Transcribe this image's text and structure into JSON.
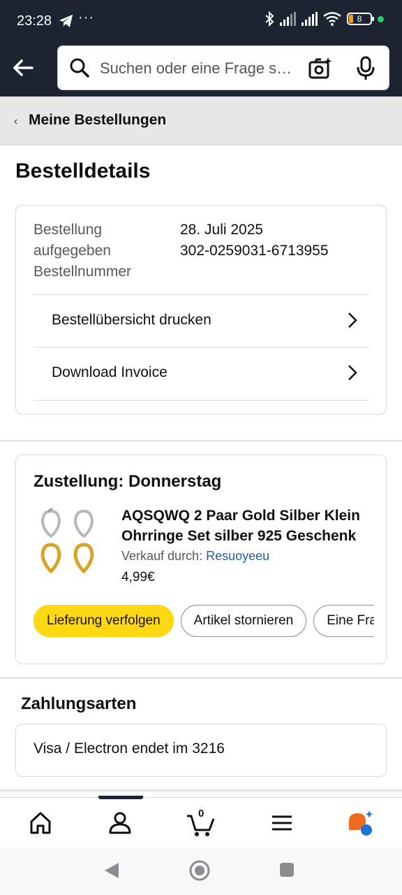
{
  "status_bar": {
    "time": "23:28",
    "dots": "···",
    "battery": "8"
  },
  "search": {
    "placeholder": "Suchen oder eine Frage stellen"
  },
  "breadcrumb": {
    "label": "Meine Bestellungen"
  },
  "page": {
    "title": "Bestelldetails"
  },
  "order": {
    "label_date": "Bestellung aufgegeben",
    "label_number": "Bestellnummer",
    "date": "28. Juli 2025",
    "number": "302-0259031-6713955",
    "actions": [
      "Bestellübersicht drucken",
      "Download Invoice"
    ]
  },
  "delivery": {
    "title": "Zustellung: Donnerstag",
    "product_title": "AQSQWQ 2 Paar Gold Silber Klein Ohrringe Set silber 925 Geschenk",
    "seller_label": "Verkauf durch:",
    "seller_name": "Resuoyeeu",
    "price": "4,99€",
    "buttons": [
      "Lieferung verfolgen",
      "Artikel stornieren",
      "Eine Frage stellen"
    ]
  },
  "payment": {
    "title": "Zahlungsarten",
    "method": "Visa / Electron  endet im 3216"
  },
  "bottom_nav": {
    "cart_count": "0"
  },
  "colors": {
    "header_bg": "#1b2430",
    "primary_button": "#ffd814",
    "link": "#2162a1"
  }
}
